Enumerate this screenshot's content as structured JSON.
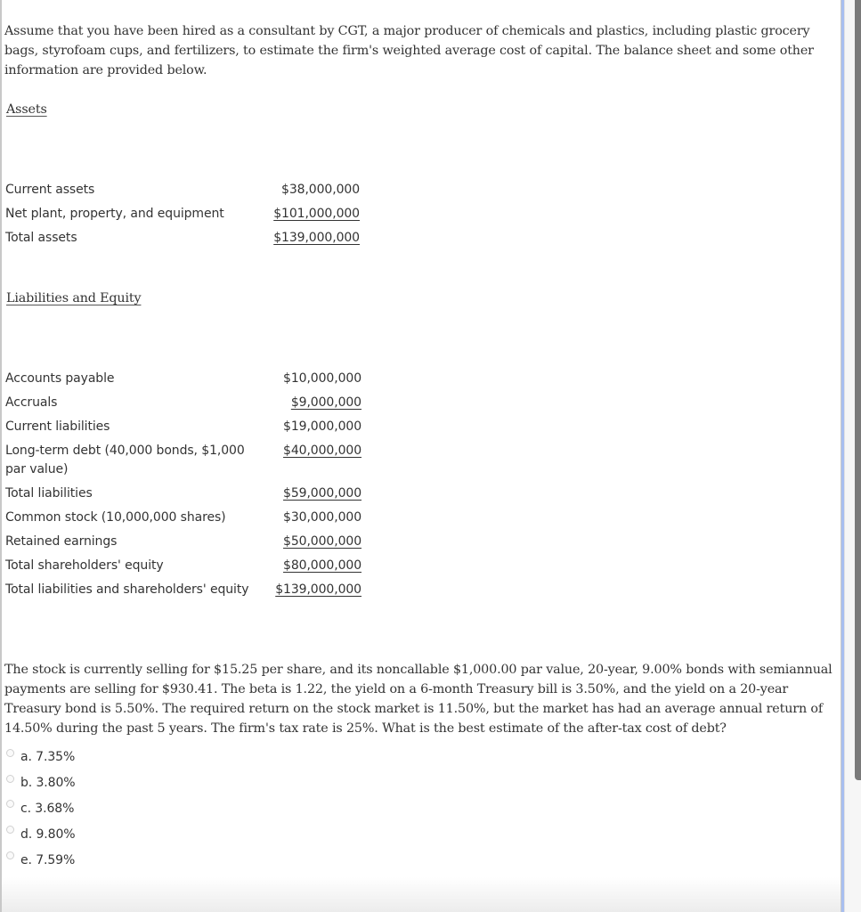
{
  "intro": "Assume that you have been hired as a consultant by CGT, a major producer of chemicals and plastics, including plastic grocery bags, styrofoam cups, and fertilizers, to estimate the firm's weighted average cost of capital. The balance sheet and some other information are provided below.",
  "assets": {
    "heading": "Assets",
    "rows": [
      {
        "label": "Current assets",
        "amount": "$38,000,000",
        "underlined": false
      },
      {
        "label": "Net plant, property, and equipment",
        "amount": "$101,000,000",
        "underlined": true
      },
      {
        "label": "Total assets",
        "amount": "$139,000,000",
        "underlined": true
      }
    ]
  },
  "liabilities_equity": {
    "heading": "Liabilities and Equity",
    "rows": [
      {
        "label": "Accounts payable",
        "amount": "$10,000,000",
        "underlined": false
      },
      {
        "label": "Accruals",
        "amount": "$9,000,000",
        "underlined": true
      },
      {
        "label": "Current liabilities",
        "amount": "$19,000,000",
        "underlined": false
      },
      {
        "label": "Long-term debt (40,000 bonds, $1,000 par value)",
        "amount": "$40,000,000",
        "underlined": true
      },
      {
        "label": "Total liabilities",
        "amount": "$59,000,000",
        "underlined": true
      },
      {
        "label": "Common stock (10,000,000 shares)",
        "amount": "$30,000,000",
        "underlined": false
      },
      {
        "label": "Retained earnings",
        "amount": "$50,000,000",
        "underlined": true
      },
      {
        "label": "Total shareholders' equity",
        "amount": "$80,000,000",
        "underlined": true
      },
      {
        "label": "Total liabilities and shareholders' equity",
        "amount": "$139,000,000",
        "underlined": true
      }
    ]
  },
  "question": "The stock is currently selling for $15.25 per share, and its noncallable $1,000.00 par value, 20-year, 9.00% bonds with semiannual payments are selling for $930.41. The beta is 1.22, the yield on a 6-month Treasury bill is 3.50%, and the yield on a 20-year Treasury bond is 5.50%. The required return on the stock market is 11.50%, but the market has had an average annual return of 14.50% during the past 5 years. The firm's tax rate is 25%. What is the best estimate of the after-tax cost of debt?",
  "options": [
    {
      "label": "a. 7.35%",
      "selected": false
    },
    {
      "label": "b. 3.80%",
      "selected": false
    },
    {
      "label": "c. 3.68%",
      "selected": false
    },
    {
      "label": "d. 9.80%",
      "selected": false
    },
    {
      "label": "e. 7.59%",
      "selected": false
    }
  ],
  "colors": {
    "text": "#333333",
    "accent_rule": "#a8bff0",
    "scrollbar_thumb": "#7a7a7a"
  }
}
